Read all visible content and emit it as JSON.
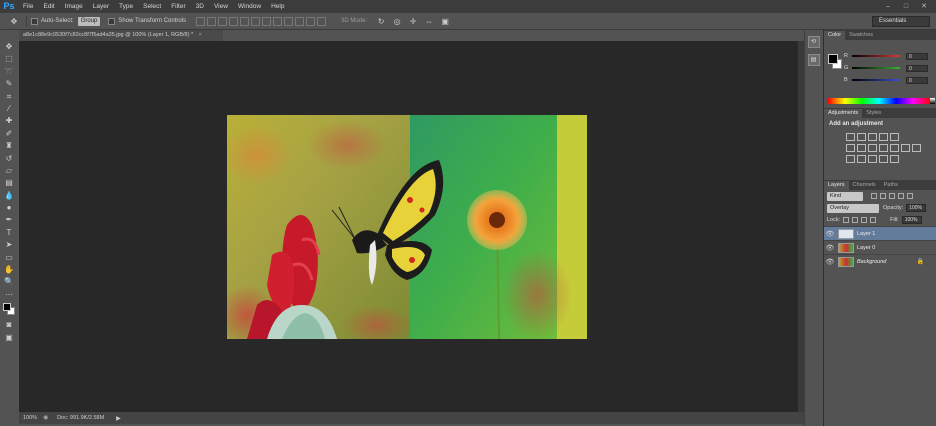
{
  "app": {
    "logo": "Ps"
  },
  "menu": [
    "File",
    "Edit",
    "Image",
    "Layer",
    "Type",
    "Select",
    "Filter",
    "3D",
    "View",
    "Window",
    "Help"
  ],
  "window_controls": [
    "–",
    "□",
    "✕"
  ],
  "options_bar": {
    "auto_select_label": "Auto-Select:",
    "auto_select_value": "Group",
    "transform_label": "Show Transform Controls",
    "mode_3d_label": "3D Mode:",
    "workspace": "Essentials"
  },
  "document": {
    "tab_title": "a8e1c88e9c0530f7c82cc8f7f5ad4a35.jpg @ 100% (Layer 1, RGB/8) *",
    "tab_close": "×"
  },
  "status": {
    "zoom": "100%",
    "doc": "Doc: 991.9K/2.58M"
  },
  "color_panel": {
    "tabs": [
      "Color",
      "Swatches"
    ],
    "sliders": [
      {
        "label": "R",
        "value": "0",
        "color": "#d63a3a"
      },
      {
        "label": "G",
        "value": "0",
        "color": "#3ab03a"
      },
      {
        "label": "B",
        "value": "0",
        "color": "#3a4fd6"
      }
    ]
  },
  "adjustments_panel": {
    "tabs": [
      "Adjustments",
      "Styles"
    ],
    "title": "Add an adjustment"
  },
  "layers_panel": {
    "tabs": [
      "Layers",
      "Channels",
      "Paths"
    ],
    "filter": "Kind",
    "blend_mode": "Overlay",
    "opacity_label": "Opacity:",
    "opacity_value": "100%",
    "lock_label": "Lock:",
    "fill_label": "Fill:",
    "fill_value": "100%",
    "layers": [
      {
        "name": "Layer 1",
        "selected": true
      },
      {
        "name": "Layer 0",
        "selected": false
      },
      {
        "name": "Background",
        "selected": false,
        "italic": true,
        "locked": true
      }
    ]
  },
  "colors": {
    "accent": "#31a8ff",
    "selection": "#647c9c"
  }
}
